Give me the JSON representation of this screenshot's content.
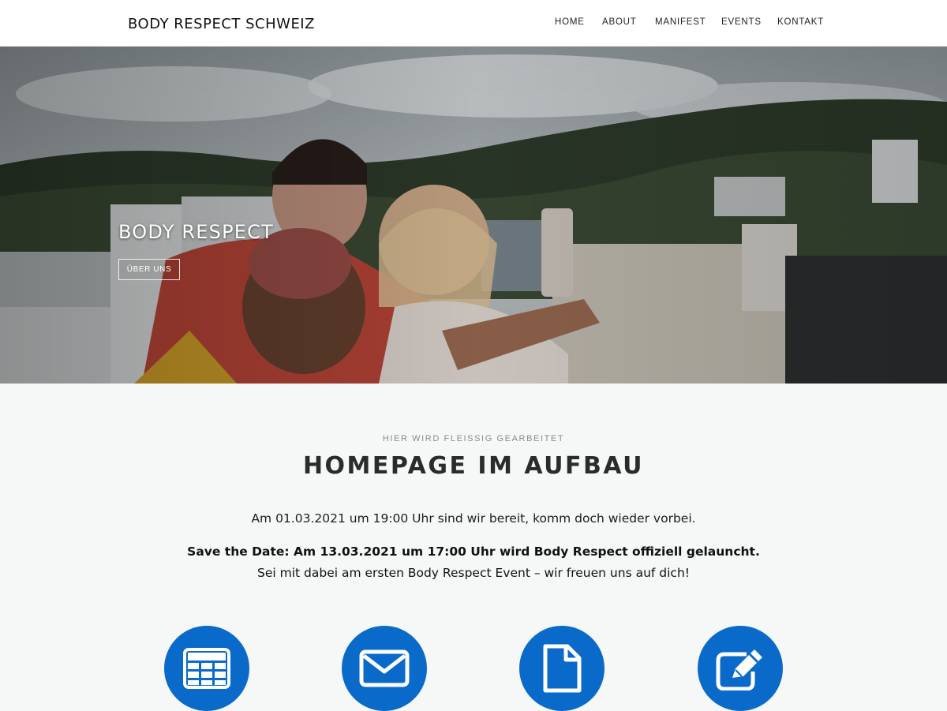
{
  "header": {
    "brand": "BODY RESPECT SCHWEIZ",
    "nav": [
      "HOME",
      "ABOUT",
      "MANIFEST",
      "EVENTS",
      "KONTAKT"
    ]
  },
  "hero": {
    "title": "BODY RESPECT",
    "button": "ÜBER UNS"
  },
  "content": {
    "eyebrow": "HIER WIRD FLEISSIG GEARBEITET",
    "headline": "HOMEPAGE IM AUFBAU",
    "paragraph1": "Am 01.03.2021 um 19:00 Uhr sind wir bereit, komm doch wieder vorbei.",
    "save_the_date": "Save the Date: Am 13.03.2021 um 17:00 Uhr wird Body Respect offiziell gelauncht.",
    "paragraph3": "Sei mit dabei am ersten Body Respect Event – wir freuen uns auf dich!"
  },
  "features": {
    "icons": [
      "table-icon",
      "envelope-icon",
      "document-icon",
      "edit-icon"
    ]
  },
  "colors": {
    "accent": "#0a6ac9",
    "section_bg": "#f6f7f7",
    "header_bg": "#ffffff"
  }
}
